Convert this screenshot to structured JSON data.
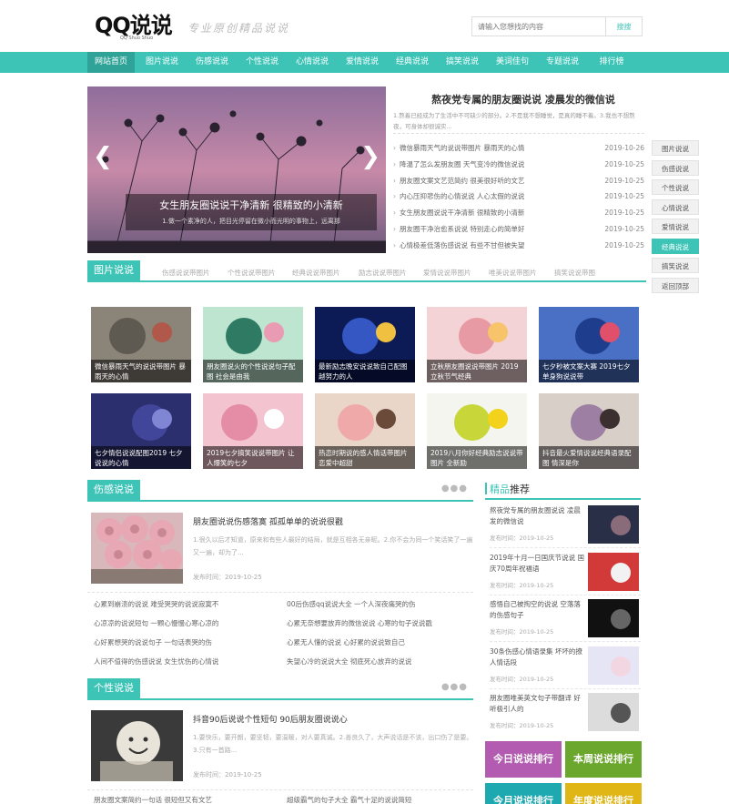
{
  "header": {
    "logo": "QQ说说",
    "logo_sub": "QQ Shuo Shuo",
    "slogan": "专业原创精品说说",
    "search_placeholder": "请输入您想找的内容",
    "search_button": "搜搜"
  },
  "nav": [
    {
      "label": "网站首页",
      "active": true
    },
    {
      "label": "图片说说"
    },
    {
      "label": "伤感说说"
    },
    {
      "label": "个性说说"
    },
    {
      "label": "心情说说"
    },
    {
      "label": "爱情说说"
    },
    {
      "label": "经典说说"
    },
    {
      "label": "搞笑说说"
    },
    {
      "label": "美词佳句"
    },
    {
      "label": "专题说说"
    },
    {
      "label": "排行榜"
    }
  ],
  "slider": {
    "caption_title": "女生朋友圈说说干净清新 很精致的小清新",
    "caption_desc": "1.做一个素净的人，把目光停留在微小而光明的事物上，远离那",
    "prev_icon": "chevron-left-icon",
    "next_icon": "chevron-right-icon"
  },
  "featured": {
    "title": "熬夜党专属的朋友圈说说 凌晨发的微信说",
    "desc": "1.熬着已经成为了生活中不可缺少的部分。2.不是我不想睡觉，是真的睡不着。3.我也不想熬夜，可身体却很诚实..."
  },
  "news": [
    {
      "title": "微信暴雨天气的说说带图片 暴雨天的心情",
      "date": "2019-10-26"
    },
    {
      "title": "降温了怎么发朋友圈 天气变冷的微信说说",
      "date": "2019-10-25"
    },
    {
      "title": "朋友圈文案文艺范简约 很美很好听的文艺",
      "date": "2019-10-25"
    },
    {
      "title": "内心压抑悲伤的心情说说 人心太假的说说",
      "date": "2019-10-25"
    },
    {
      "title": "女生朋友圈说说干净清新 很精致的小清新",
      "date": "2019-10-25"
    },
    {
      "title": "朋友圈干净治愈系说说 特别走心的简单好",
      "date": "2019-10-25"
    },
    {
      "title": "心情极差低落伤感说说 有些不甘但被失望",
      "date": "2019-10-25"
    }
  ],
  "side_tags": [
    {
      "label": "图片说说"
    },
    {
      "label": "伤感说说"
    },
    {
      "label": "个性说说"
    },
    {
      "label": "心情说说"
    },
    {
      "label": "爱情说说"
    },
    {
      "label": "经典说说",
      "active": true
    },
    {
      "label": "搞笑说说"
    },
    {
      "label": "返回顶部"
    }
  ],
  "pic_section": {
    "title": "图片说说",
    "tabs": [
      "伤感说说带图片",
      "个性说说带图片",
      "经典说说带图片",
      "励志说说带图片",
      "爱情说说带图片",
      "唯美说说带图片",
      "搞笑说说带图"
    ],
    "cards": [
      {
        "caption": "微信暴雨天气的说说带图片 暴雨天的心情"
      },
      {
        "caption": "朋友圈说火的个性说说句子配图 社会是由我"
      },
      {
        "caption": "最新励志晚安说说致自己配图 越努力的人"
      },
      {
        "caption": "立秋朋友圈说说带图片 2019立秋节气经典"
      },
      {
        "caption": "七夕秒被文案大赛 2019七夕单身狗说说带"
      },
      {
        "caption": "七夕情侣说说配图2019 七夕说说的心情"
      },
      {
        "caption": "2019七夕搞笑说说带图片 让人爆笑的七夕"
      },
      {
        "caption": "热恋时期说的感人情话带图片 恋爱中超甜"
      },
      {
        "caption": "2019八月你好经典励志说说带图片 全新励"
      },
      {
        "caption": "抖音最火爱情说说经典语录配图 情深是你"
      }
    ]
  },
  "sad_section": {
    "title": "伤感说说",
    "more_icon": "ellipsis-icon",
    "lead_title": "朋友圈说说伤感落寞 孤孤单单的说说很戳",
    "lead_desc": "1.很久以后才知道，原来和有些人最好的结局，就是互相各无亲昵。2.你不会为同一个笑话笑了一遍又一遍，却为了...",
    "lead_time": "发布时间：2019-10-25",
    "items": [
      "心累到崩溃的说说 难受哭哭的说说寂寞不",
      "00后伤感qq说说大全 一个人深夜痛哭的伤",
      "心凉凉的说说短句 一颗心慢慢心寒心凉的",
      "心累无奈想要放弃的微信说说 心寒的句子说说戳",
      "心好累想哭的说说句子 一句话表哭的伤",
      "心累无人懂的说说 心好累的说说致自己",
      "人间不值得的伤感说说 女生忧伤的心情说",
      "失望心冷的说说大全 彻底死心放弃的说说"
    ]
  },
  "personal_section": {
    "title": "个性说说",
    "more_icon": "ellipsis-icon",
    "lead_title": "抖音90后说说个性短句 90后朋友圈说说心",
    "lead_desc": "1.要快乐，要开朗，要坚韧，要温暖，对人要真诚。2.善良久了，大声说话是不该，出口伤了是要。3.只有一首路...",
    "lead_time": "发布时间：2019-10-25",
    "items": [
      "朋友圈文案简约一句话 很短但又有文艺",
      "超级霸气的句子大全 霸气十足的说说简短"
    ]
  },
  "recommend": {
    "title_a": "精品",
    "title_b": "推荐",
    "items": [
      {
        "title": "熬夜党专属的朋友圈说说 凌晨发的微信说",
        "time": "发布时间：2019-10-25"
      },
      {
        "title": "2019年十月一日国庆节说说 国庆70周年祝福语",
        "time": "发布时间：2019-10-25"
      },
      {
        "title": "感悟自己被掏空的说说 空落落的伤感句子",
        "time": "发布时间：2019-10-25"
      },
      {
        "title": "30条伤感心情语录集 坏坏的撩人情话段",
        "time": "发布时间：2019-10-25"
      },
      {
        "title": "朋友圈唯美英文句子带翻译 好听极引人的",
        "time": "发布时间：2019-10-25"
      }
    ]
  },
  "ranks": [
    {
      "label": "今日说说排行",
      "color": "#b25bb0"
    },
    {
      "label": "本周说说排行",
      "color": "#6aa72c"
    },
    {
      "label": "今月说说排行",
      "color": "#1ea9b0"
    },
    {
      "label": "年度说说排行",
      "color": "#e0b516"
    }
  ],
  "colors": {
    "accent": "#3ec4b7",
    "accent_dark": "#2fa397"
  }
}
